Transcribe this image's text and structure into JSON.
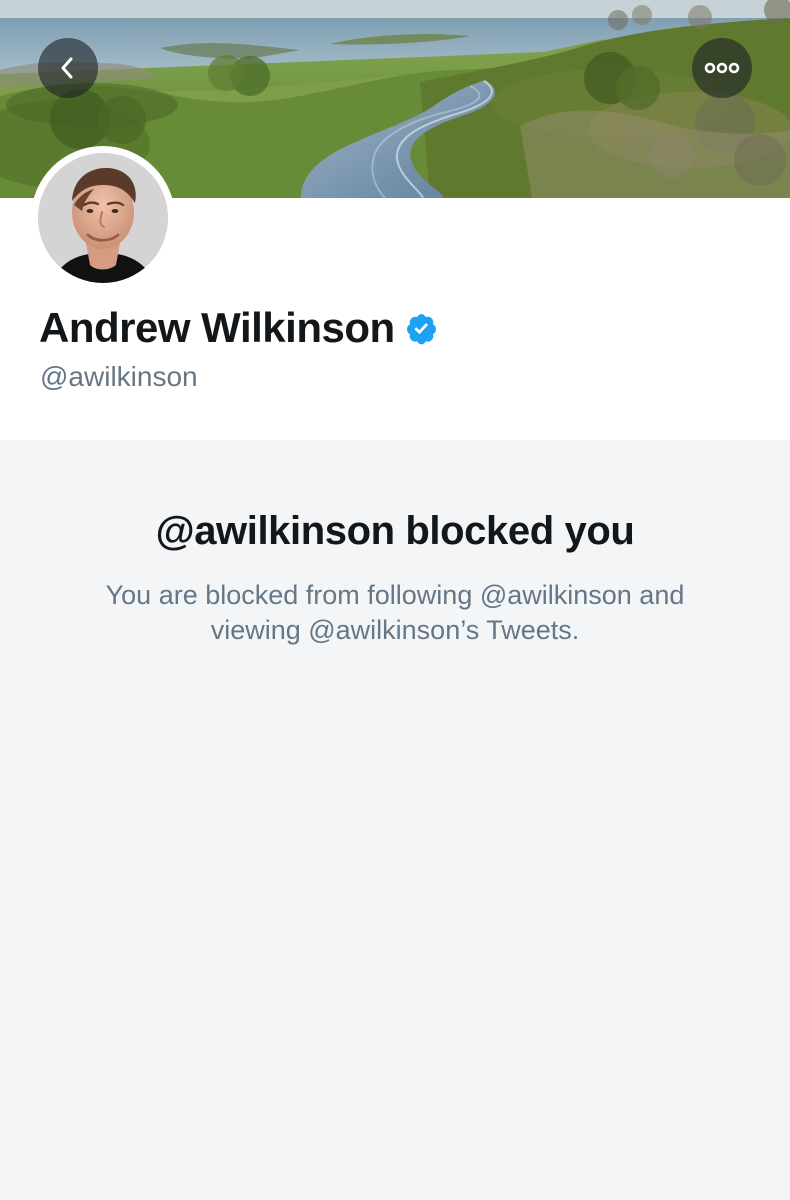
{
  "profile": {
    "display_name": "Andrew Wilkinson",
    "handle": "@awilkinson",
    "verified": true
  },
  "blocked_notice": {
    "title": "@awilkinson blocked you",
    "message": "You are blocked from following @awilkinson and viewing @awilkinson’s Tweets."
  },
  "icons": {
    "back": "back-arrow-icon",
    "more": "more-options-icon",
    "verified": "verified-badge-icon"
  },
  "colors": {
    "name": "#14171a",
    "secondary_text": "#657786",
    "verified_blue": "#1da1f2",
    "background": "#f4f5f7",
    "card_background": "#ffffff"
  }
}
